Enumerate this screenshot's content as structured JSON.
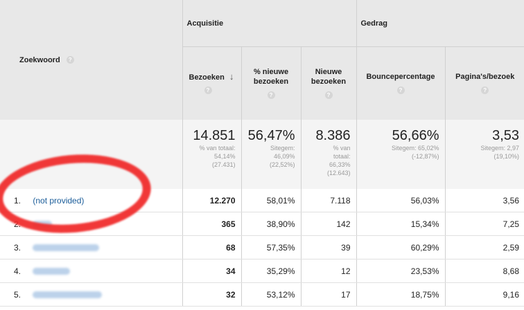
{
  "header": {
    "keyword_label": "Zoekwoord",
    "group_acquisition": "Acquisitie",
    "group_behavior": "Gedrag",
    "help_glyph": "?",
    "columns": [
      {
        "label_l1": "Bezoeken",
        "label_l2": "",
        "label_l3": "",
        "sorted": true
      },
      {
        "label_l1": "% nieuwe",
        "label_l2": "bezoeken",
        "label_l3": ""
      },
      {
        "label_l1": "Nieuwe",
        "label_l2": "bezoeken",
        "label_l3": ""
      },
      {
        "label_l1": "Bouncepercentage",
        "label_l2": "",
        "label_l3": ""
      },
      {
        "label_l1": "Pagina's/bezoek",
        "label_l2": "",
        "label_l3": ""
      }
    ],
    "sort_arrow": "↓"
  },
  "summary": [
    {
      "value": "14.851",
      "l1": "% van totaal:",
      "l2": "54,14%",
      "l3": "(27.431)",
      "l4": ""
    },
    {
      "value": "56,47%",
      "l1": "Sitegem:",
      "l2": "46,09%",
      "l3": "(22,52%)",
      "l4": ""
    },
    {
      "value": "8.386",
      "l1": "% van",
      "l2": "totaal:",
      "l3": "66,33%",
      "l4": "(12.643)"
    },
    {
      "value": "56,66%",
      "l1": "Sitegem: 65,02%",
      "l2": "(-12,87%)",
      "l3": "",
      "l4": ""
    },
    {
      "value": "3,53",
      "l1": "Sitegem: 2,97",
      "l2": "(19,10%)",
      "l3": "",
      "l4": ""
    }
  ],
  "rows": [
    {
      "index": "1.",
      "keyword": "(not provided)",
      "visits": "12.270",
      "new_pct": "58,01%",
      "new_visits": "7.118",
      "bounce": "56,03%",
      "pages": "3,56"
    },
    {
      "index": "2.",
      "keyword": "",
      "visits": "365",
      "new_pct": "38,90%",
      "new_visits": "142",
      "bounce": "15,34%",
      "pages": "7,25"
    },
    {
      "index": "3.",
      "keyword": "",
      "visits": "68",
      "new_pct": "57,35%",
      "new_visits": "39",
      "bounce": "60,29%",
      "pages": "2,59"
    },
    {
      "index": "4.",
      "keyword": "",
      "visits": "34",
      "new_pct": "35,29%",
      "new_visits": "12",
      "bounce": "23,53%",
      "pages": "8,68"
    },
    {
      "index": "5.",
      "keyword": "",
      "visits": "32",
      "new_pct": "53,12%",
      "new_visits": "17",
      "bounce": "18,75%",
      "pages": "9,16"
    }
  ],
  "colors": {
    "link": "#1a5c99",
    "annotation_ring": "#f02828",
    "header_bg": "#e8e8e8"
  }
}
